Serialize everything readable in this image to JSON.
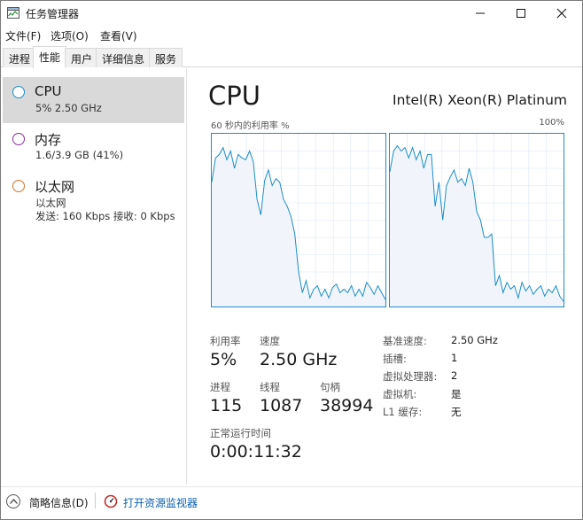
{
  "window": {
    "title": "任务管理器",
    "minimize_icon": "minimize-icon",
    "maximize_icon": "maximize-icon",
    "close_icon": "close-icon"
  },
  "menu": [
    "文件(F)",
    "选项(O)",
    "查看(V)"
  ],
  "tabs": [
    "进程",
    "性能",
    "用户",
    "详细信息",
    "服务"
  ],
  "active_tab": "性能",
  "sidebar": {
    "items": [
      {
        "name": "CPU",
        "sub": "5% 2.50 GHz",
        "sub2": "",
        "circle_color": "#1c8ec8",
        "selected": true
      },
      {
        "name": "内存",
        "sub": "1.6/3.9 GB (41%)",
        "sub2": "",
        "circle_color": "#8b2fa0",
        "selected": false
      },
      {
        "name": "以太网",
        "sub": "以太网",
        "sub2": "发送: 160 Kbps  接收: 0 Kbps",
        "circle_color": "#d9722a",
        "selected": false
      }
    ]
  },
  "main": {
    "title": "CPU",
    "cpu_model": "Intel(R) Xeon(R) Platinum",
    "graph_caption_left": "60 秒内的利用率 %",
    "graph_caption_right": "100%",
    "graph_line_color": "#1c8ec8",
    "graph_fill_color": "#f1f5fb",
    "stats": {
      "utilization_label": "利用率",
      "utilization_value": "5%",
      "speed_label": "速度",
      "speed_value": "2.50 GHz",
      "processes_label": "进程",
      "processes_value": "115",
      "threads_label": "线程",
      "threads_value": "1087",
      "handles_label": "句柄",
      "handles_value": "38994",
      "uptime_label": "正常运行时间",
      "uptime_value": "0:00:11:32"
    },
    "info": [
      {
        "label": "基准速度:",
        "value": "2.50 GHz"
      },
      {
        "label": "插槽:",
        "value": "1"
      },
      {
        "label": "虚拟处理器:",
        "value": "2"
      },
      {
        "label": "虚拟机:",
        "value": "是"
      },
      {
        "label": "L1 缓存:",
        "value": "无"
      }
    ]
  },
  "footer": {
    "fewer_details": "简略信息(D)",
    "open_monitor": "打开资源监视器"
  },
  "chart_data": [
    {
      "type": "area",
      "x_unit": "seconds",
      "ylim": [
        0,
        100
      ],
      "values": [
        72,
        86,
        88,
        92,
        85,
        90,
        80,
        88,
        86,
        85,
        90,
        84,
        62,
        53,
        73,
        79,
        70,
        74,
        72,
        62,
        58,
        52,
        42,
        20,
        8,
        15,
        5,
        10,
        12,
        6,
        10,
        5,
        11,
        13,
        8,
        10,
        8,
        12,
        6,
        10,
        6,
        14,
        11,
        7,
        12,
        8,
        4
      ]
    },
    {
      "type": "area",
      "x_unit": "seconds",
      "ylim": [
        0,
        100
      ],
      "values": [
        78,
        90,
        93,
        90,
        92,
        86,
        92,
        85,
        90,
        80,
        88,
        88,
        58,
        72,
        50,
        70,
        75,
        79,
        72,
        74,
        70,
        80,
        72,
        55,
        50,
        40,
        40,
        42,
        12,
        18,
        8,
        14,
        10,
        12,
        5,
        14,
        9,
        12,
        7,
        10,
        12,
        6,
        10,
        8,
        12,
        6,
        3
      ]
    }
  ]
}
